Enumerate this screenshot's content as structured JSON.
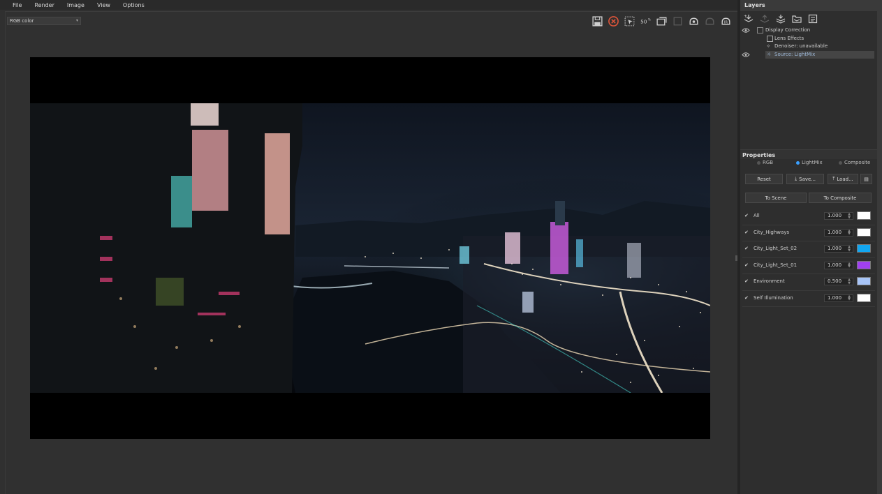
{
  "menu": [
    "File",
    "Render",
    "Image",
    "View",
    "Options"
  ],
  "channel_select": "RGB color",
  "toolbar_icons": [
    "save-icon",
    "clear-icon",
    "region-render-icon",
    "zoom-50-icon",
    "track-mouse-icon",
    "region-icon",
    "render-icon",
    "stop-icon",
    "render-interactive-icon"
  ],
  "toolbar_zoom_label": "50",
  "layers": {
    "title": "Layers",
    "tree": [
      {
        "label": "Display Correction",
        "visible": true
      },
      {
        "label": "Lens Effects",
        "visible": false
      },
      {
        "label": "Denoiser: unavailable",
        "visible": false
      },
      {
        "label": "Source: LightMix",
        "visible": true,
        "selected": true
      }
    ]
  },
  "properties": {
    "title": "Properties",
    "modes": [
      {
        "label": "RGB",
        "selected": false
      },
      {
        "label": "LightMix",
        "selected": true
      },
      {
        "label": "Composite",
        "selected": false
      }
    ],
    "buttons": {
      "reset": "Reset",
      "save": "Save...",
      "load": "Load...",
      "to_scene": "To Scene",
      "to_composite": "To Composite"
    },
    "lights": [
      {
        "name": "All",
        "value": "1.000",
        "color": "#ffffff"
      },
      {
        "name": "City_Highways",
        "value": "1.000",
        "color": "#ffffff"
      },
      {
        "name": "City_Light_Set_02",
        "value": "1.000",
        "color": "#12a6f0"
      },
      {
        "name": "City_Light_Set_01",
        "value": "1.000",
        "color": "#a040f0"
      },
      {
        "name": "Environment",
        "value": "0.500",
        "color": "#a7c4f7"
      },
      {
        "name": "Self Illumination",
        "value": "1.000",
        "color": "#ffffff"
      }
    ]
  }
}
